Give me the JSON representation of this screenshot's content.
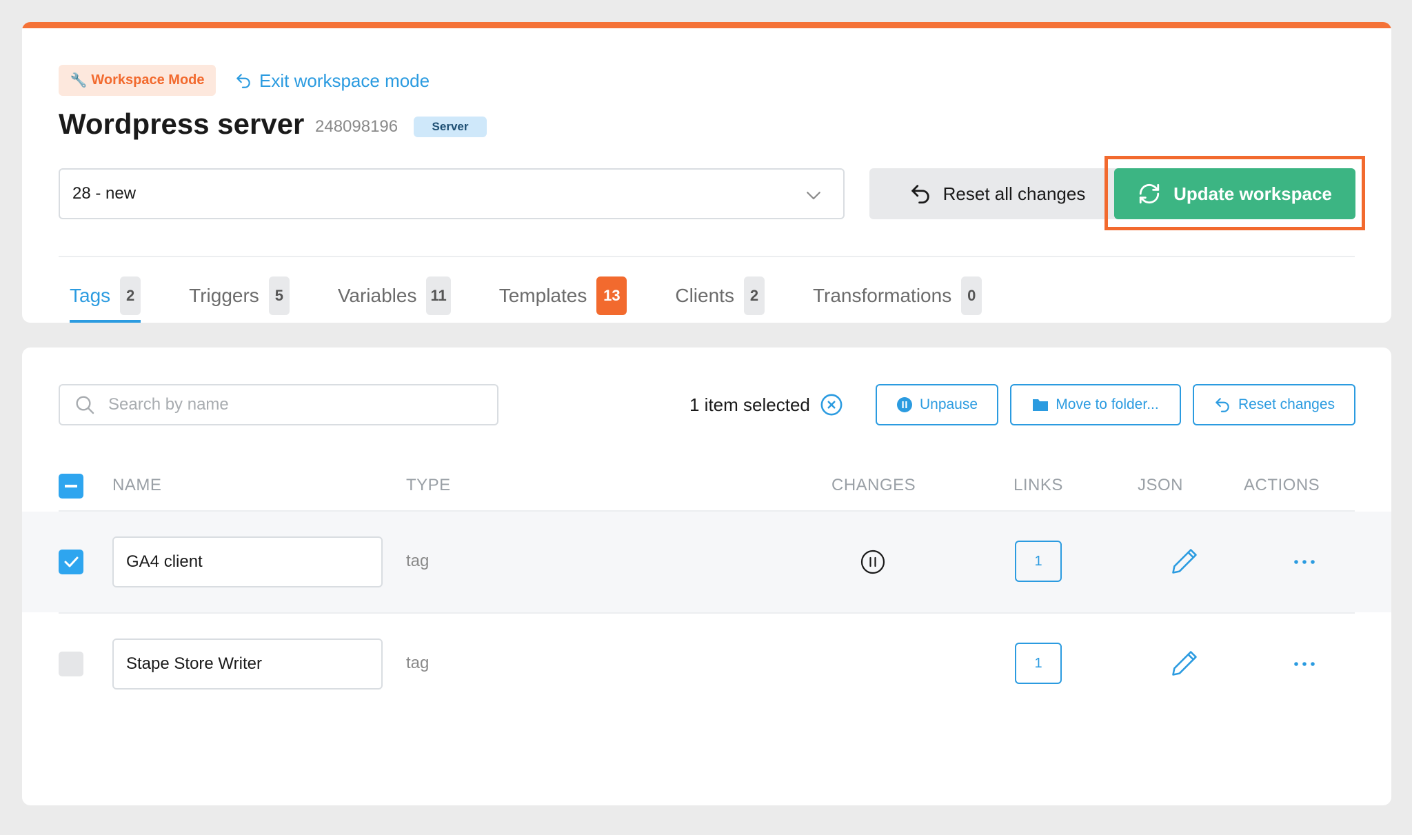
{
  "header": {
    "mode_badge": "Workspace Mode",
    "exit_link": "Exit workspace mode",
    "title": "Wordpress server",
    "server_id": "248098196",
    "server_badge": "Server",
    "version_selected": "28 - new",
    "reset_all_label": "Reset all changes",
    "update_label": "Update workspace"
  },
  "tabs": [
    {
      "label": "Tags",
      "count": "2",
      "active": true
    },
    {
      "label": "Triggers",
      "count": "5"
    },
    {
      "label": "Variables",
      "count": "11"
    },
    {
      "label": "Templates",
      "count": "13",
      "alert": true
    },
    {
      "label": "Clients",
      "count": "2"
    },
    {
      "label": "Transformations",
      "count": "0"
    }
  ],
  "toolbar": {
    "search_placeholder": "Search by name",
    "selected_text": "1 item selected",
    "unpause_label": "Unpause",
    "move_label": "Move to folder...",
    "reset_label": "Reset changes"
  },
  "table": {
    "columns": {
      "name": "NAME",
      "type": "TYPE",
      "changes": "CHANGES",
      "links": "LINKS",
      "json": "JSON",
      "actions": "ACTIONS"
    },
    "rows": [
      {
        "name": "GA4 client",
        "type": "tag",
        "links": "1",
        "checked": true,
        "change": "paused"
      },
      {
        "name": "Stape Store Writer",
        "type": "tag",
        "links": "1",
        "checked": false
      }
    ]
  },
  "colors": {
    "accent": "#2b9be0",
    "brand_orange": "#f26a2e",
    "success": "#3cb583"
  },
  "icons": [
    "wrench-icon",
    "undo-arrow-icon",
    "chevron-down-icon",
    "refresh-icon",
    "search-icon",
    "close-circle-icon",
    "pause-icon",
    "folder-icon",
    "pencil-icon",
    "more-icon",
    "check-icon"
  ]
}
